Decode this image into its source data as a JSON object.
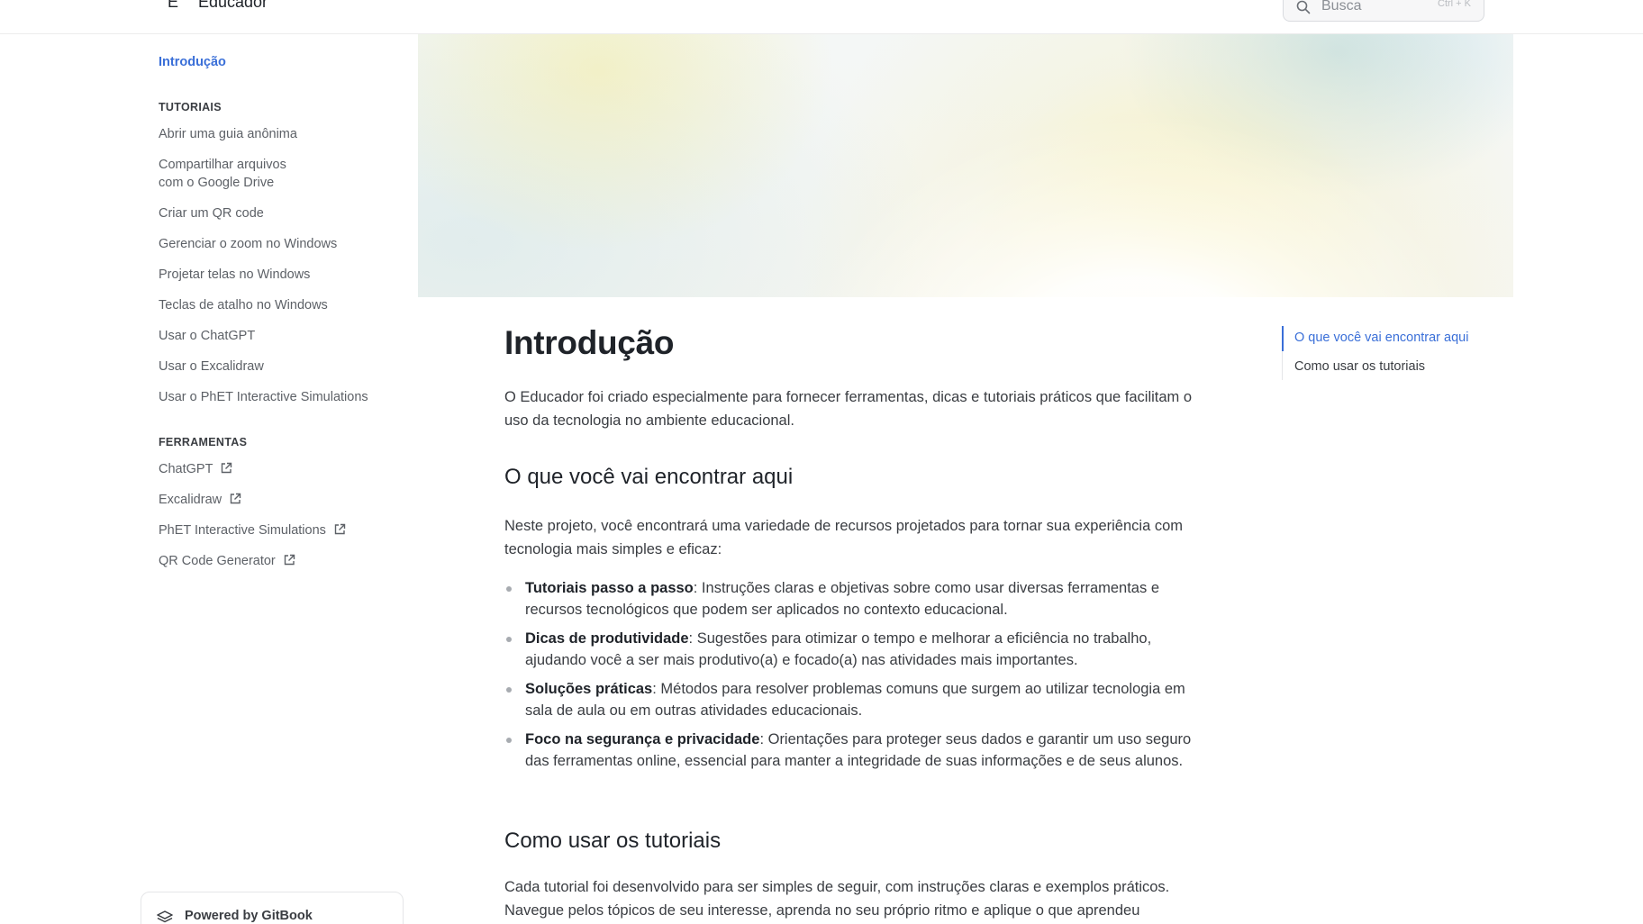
{
  "header": {
    "logo_letter": "E",
    "site_title": "Educador",
    "search_placeholder": "Busca",
    "search_shortcut": "Ctrl + K"
  },
  "sidebar": {
    "intro": "Introdução",
    "sections": [
      {
        "title": "TUTORIAIS",
        "items": [
          "Abrir uma guia anônima",
          "Compartilhar arquivos",
          "com o Google Drive",
          "Criar um QR code",
          "Gerenciar o zoom no Windows",
          "Projetar telas no Windows",
          "Teclas de atalho no Windows",
          "Usar o ChatGPT",
          "Usar o Excalidraw",
          "Usar o PhET Interactive Simulations"
        ]
      },
      {
        "title": "FERRAMENTAS",
        "items": [
          "ChatGPT",
          "Excalidraw",
          "PhET Interactive Simulations",
          "QR Code Generator"
        ]
      }
    ],
    "powered_by": "Powered by GitBook"
  },
  "main": {
    "title": "Introdução",
    "intro_paragraph": "O Educador foi criado especialmente para fornecer ferramentas, dicas e tutoriais práticos que facilitam o uso da tecnologia no ambiente educacional.",
    "section1": {
      "heading": "O que você vai encontrar aqui",
      "paragraph": "Neste projeto, você encontrará uma variedade de recursos projetados para tornar sua experiência com tecnologia mais simples e eficaz:",
      "bullets": [
        {
          "bold": "Tutoriais passo a passo",
          "text": ": Instruções claras e objetivas sobre como usar diversas ferramentas e recursos tecnológicos que podem ser aplicados no contexto educacional."
        },
        {
          "bold": "Dicas de produtividade",
          "text": ": Sugestões para otimizar o tempo e melhorar a eficiência no trabalho, ajudando você a ser mais produtivo(a) e focado(a) nas atividades mais importantes."
        },
        {
          "bold": "Soluções práticas",
          "text": ": Métodos para resolver problemas comuns que surgem ao utilizar tecnologia em sala de aula ou em outras atividades educacionais."
        },
        {
          "bold": "Foco na segurança e privacidade",
          "text": ": Orientações para proteger seus dados e garantir um uso seguro das ferramentas online, essencial para manter a integridade de suas informações e de seus alunos."
        }
      ]
    },
    "section2": {
      "heading": "Como usar os tutoriais",
      "paragraph": "Cada tutorial foi desenvolvido para ser simples de seguir, com instruções claras e exemplos práticos. Navegue pelos tópicos de seu interesse, aprenda no seu próprio ritmo e aplique o que aprendeu"
    }
  },
  "toc": {
    "items": [
      "O que você vai encontrar aqui",
      "Como usar os tutoriais"
    ]
  },
  "colors": {
    "accent": "#3a6fd8",
    "text": "#1f2329",
    "muted": "#5d6167"
  }
}
